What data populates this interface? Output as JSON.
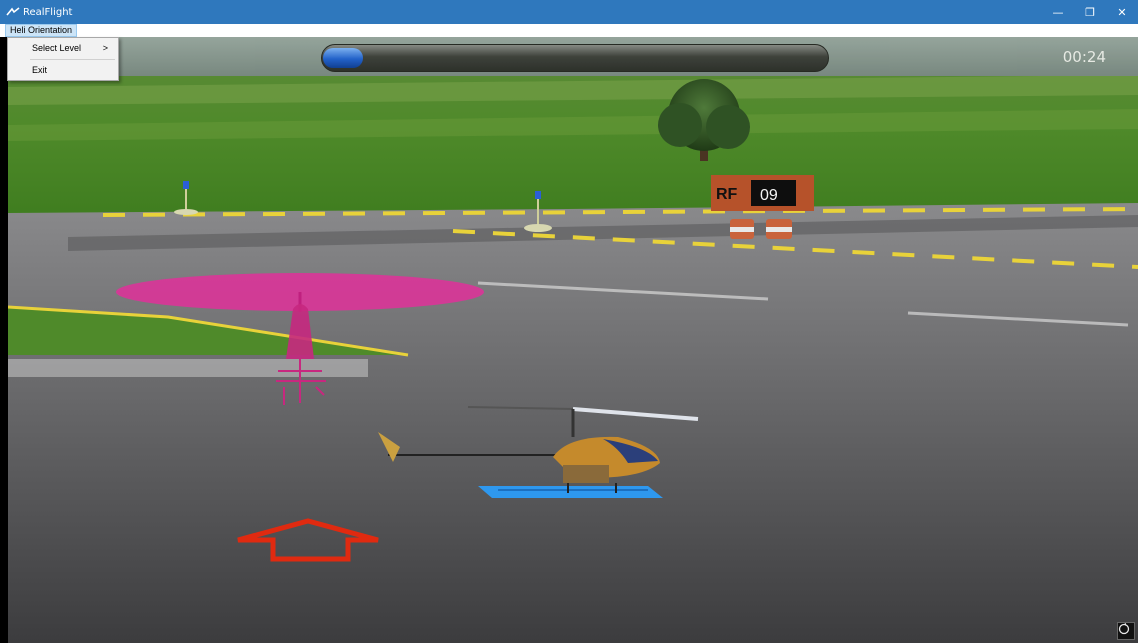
{
  "window": {
    "title": "RealFlight",
    "controls": {
      "minimize": "—",
      "restore": "❐",
      "close": "✕"
    }
  },
  "menu": {
    "root": "Heli Orientation",
    "items": [
      {
        "label": "Select Level",
        "arrow": ">"
      },
      {
        "label": "Exit"
      }
    ]
  },
  "hud": {
    "progress_fraction": 0.08,
    "timer": "00:24"
  },
  "scene": {
    "sign_prefix": "RF",
    "sign_number": "09"
  },
  "icons": {
    "app": "realflight-logo-icon",
    "reset": "reset-view-icon"
  },
  "colors": {
    "titlebar": "#2f78bd",
    "ghost_heli": "#e0309a",
    "landing_pad": "#2aa0ff",
    "arrow": "#e02a10"
  }
}
